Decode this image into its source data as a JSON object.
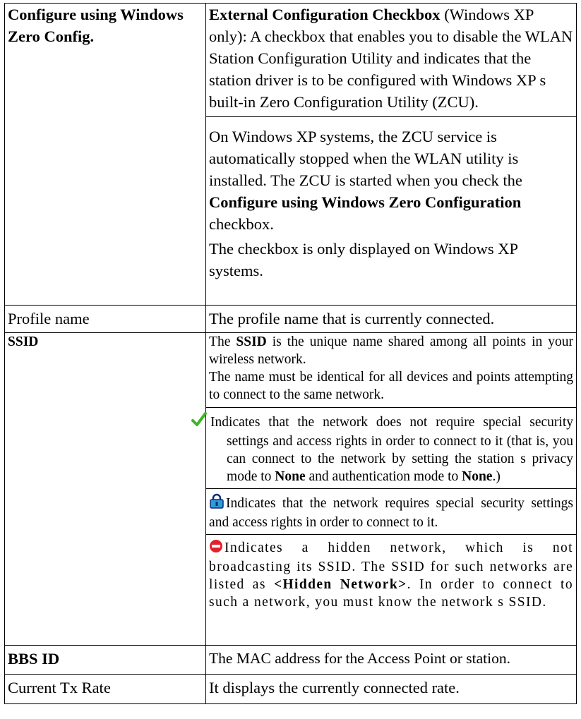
{
  "rows": {
    "zero_config": {
      "label": "Configure using Windows Zero Config.",
      "p1_bold": "External Configuration Checkbox",
      "p1_text": " (Windows XP only): A checkbox that enables you to disable the WLAN Station Configuration Utility and indicates that the station driver is to be configured with Windows XP s built-in Zero Configuration Utility (ZCU).",
      "p2_pre": "On Windows XP systems, the ZCU service is automatically stopped when the WLAN utility is installed. The ZCU is started when you check the ",
      "p2_bold": "Configure using Windows Zero Configuration",
      "p2_post": " checkbox.",
      "p3": "The checkbox is only displayed on Windows XP systems."
    },
    "profile": {
      "label": "Profile name",
      "desc": "The profile name that is currently connected."
    },
    "ssid": {
      "label": "SSID",
      "p1_pre": "The ",
      "p1_bold": "SSID",
      "p1_post": " is the unique name shared among all points in your wireless network.",
      "p2": "The name must be identical for all devices and points attempting to connect to the same network.",
      "open": {
        "icon": "green-checkmark-icon",
        "color": "#3cb524",
        "pre": "Indicates that the network does not require special security settings and access rights in order to connect to it (that is, you can connect to the network by setting the station s privacy mode to ",
        "b1": "None",
        "mid": " and authentication mode to ",
        "b2": "None",
        "post": ".)"
      },
      "secure": {
        "icon": "padlock-icon",
        "color": "#2f9bd6",
        "text": "Indicates that the network requires special security settings and access rights in order to connect to it."
      },
      "hidden": {
        "icon": "red-no-entry-icon",
        "color": "#e4202a",
        "pre": "Indicates a hidden network, which is not broadcasting its SSID. The SSID for such networks are listed as ",
        "bold": "<Hidden Network>",
        "post": ". In order to connect to such a network, you must know the network s SSID."
      }
    },
    "bbs": {
      "label": "BBS ID",
      "desc": "The MAC address for the Access Point or station."
    },
    "txrate": {
      "label": "Current Tx Rate",
      "desc": "It displays the currently connected rate."
    }
  }
}
